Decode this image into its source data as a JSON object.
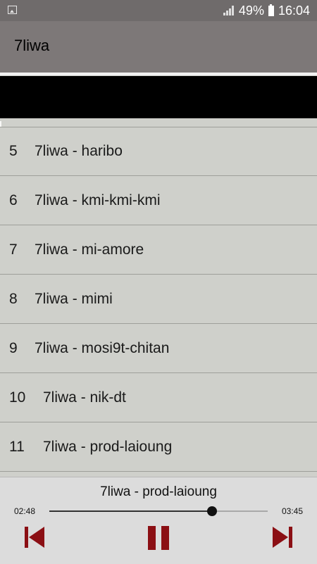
{
  "statusbar": {
    "battery": "49%",
    "time": "16:04",
    "icons": [
      "image-icon",
      "signal-icon",
      "battery-icon"
    ]
  },
  "appbar": {
    "title": "7liwa"
  },
  "tracks": [
    {
      "num": "5",
      "title": "7liwa - haribo"
    },
    {
      "num": "6",
      "title": "7liwa - kmi-kmi-kmi"
    },
    {
      "num": "7",
      "title": "7liwa - mi-amore"
    },
    {
      "num": "8",
      "title": "7liwa - mimi"
    },
    {
      "num": "9",
      "title": "7liwa - mosi9t-chitan"
    },
    {
      "num": "10",
      "title": "7liwa - nik-dt"
    },
    {
      "num": "11",
      "title": "7liwa - prod-laioung"
    }
  ],
  "player": {
    "now_playing": "7liwa - prod-laioung",
    "current_time": "02:48",
    "total_time": "03:45",
    "progress": 0.745,
    "accent": "#8b0f14",
    "controls": [
      "skip-previous-icon",
      "pause-icon",
      "skip-next-icon"
    ]
  }
}
